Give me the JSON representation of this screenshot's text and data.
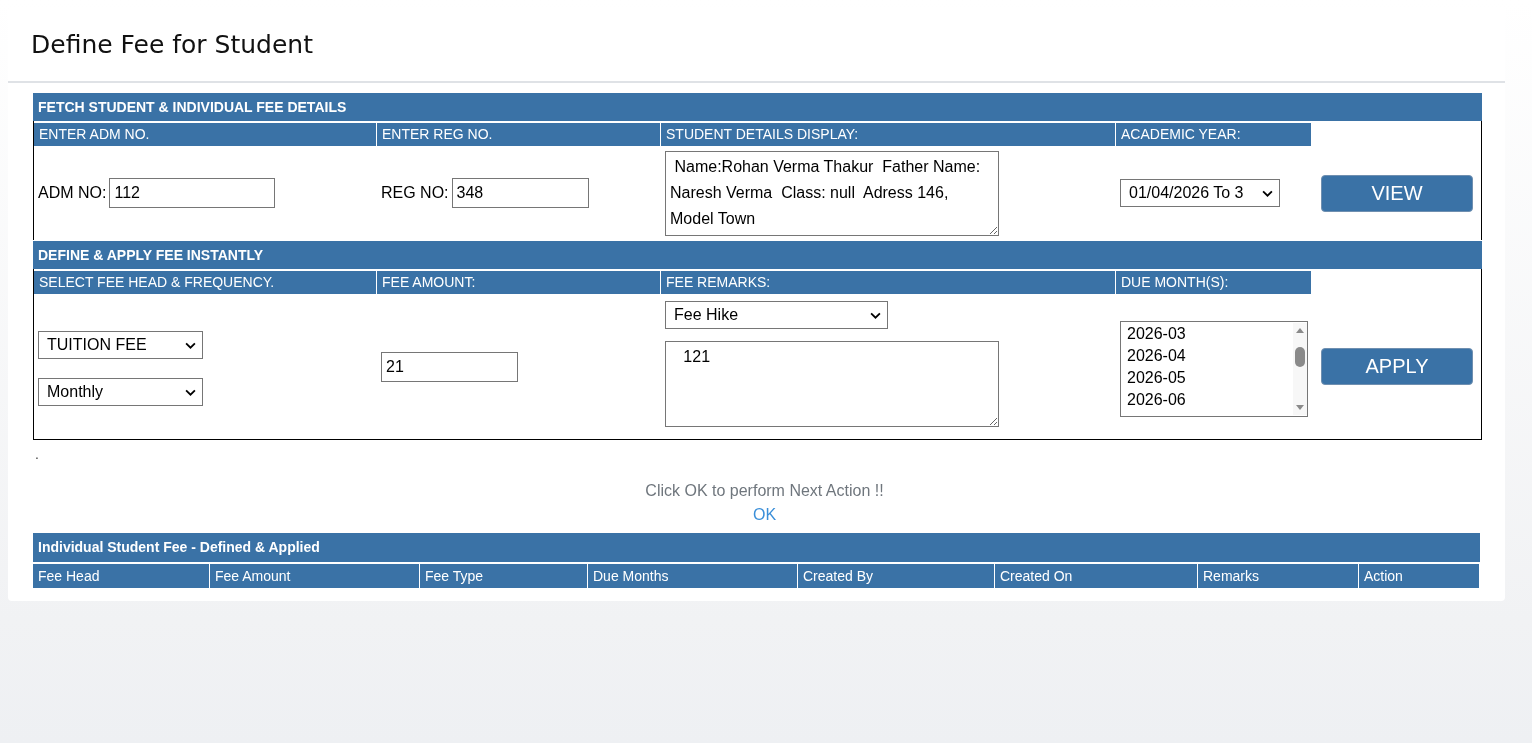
{
  "page_title": "Define Fee for Student",
  "fetch_section": {
    "title": "FETCH STUDENT & INDIVIDUAL FEE DETAILS",
    "columns": [
      "ENTER ADM NO.",
      "ENTER REG NO.",
      "STUDENT DETAILS DISPLAY:",
      "ACADEMIC YEAR:"
    ],
    "adm_label": "ADM NO:",
    "adm_value": "112",
    "reg_label": "REG NO:",
    "reg_value": "348",
    "student_details": " Name:Rohan Verma Thakur  Father Name: Naresh Verma  Class: null  Adress 146, Model Town",
    "academic_year": "01/04/2026 To 3",
    "button": "VIEW"
  },
  "apply_section": {
    "title": "DEFINE & APPLY FEE INSTANTLY",
    "columns": [
      "SELECT FEE HEAD & FREQUENCY.",
      "FEE AMOUNT:",
      "FEE REMARKS:",
      "DUE MONTH(S):"
    ],
    "fee_head": "TUITION FEE",
    "frequency": "Monthly",
    "fee_amount": "21",
    "remark_type": "Fee Hike",
    "remarks": "   121",
    "due_months": [
      {
        "label": "2026-03",
        "selected": false
      },
      {
        "label": "2026-04",
        "selected": false
      },
      {
        "label": "2026-05",
        "selected": false
      },
      {
        "label": "2026-06",
        "selected": false
      }
    ],
    "button": "APPLY"
  },
  "dot": ".",
  "message": "Click OK to perform Next Action !!",
  "ok_link": "OK",
  "fee_table": {
    "title": "Individual Student Fee - Defined & Applied",
    "columns": [
      "Fee Head",
      "Fee Amount",
      "Fee Type",
      "Due Months",
      "Created By",
      "Created On",
      "Remarks",
      "Action"
    ]
  }
}
